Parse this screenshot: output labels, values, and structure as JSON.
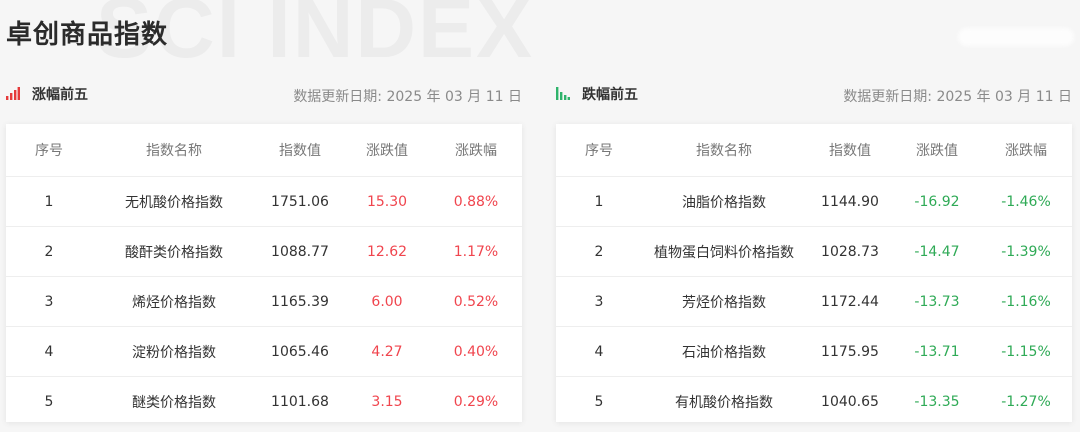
{
  "watermark": "SCI INDEX",
  "page_title": "卓创商品指数",
  "colors": {
    "up": "#f0454e",
    "down": "#2faa56",
    "icon_red": "#e53a3a",
    "icon_green": "#2fb36b"
  },
  "gainers": {
    "icon": "bar-chart-up-icon",
    "title": "涨幅前五",
    "date": "数据更新日期: 2025 年 03 月 11 日",
    "headers": [
      "序号",
      "指数名称",
      "指数值",
      "涨跌值",
      "涨跌幅"
    ],
    "rows": [
      [
        "1",
        "无机酸价格指数",
        "1751.06",
        "15.30",
        "0.88%"
      ],
      [
        "2",
        "酸酐类价格指数",
        "1088.77",
        "12.62",
        "1.17%"
      ],
      [
        "3",
        "烯烃价格指数",
        "1165.39",
        "6.00",
        "0.52%"
      ],
      [
        "4",
        "淀粉价格指数",
        "1065.46",
        "4.27",
        "0.40%"
      ],
      [
        "5",
        "醚类价格指数",
        "1101.68",
        "3.15",
        "0.29%"
      ]
    ]
  },
  "losers": {
    "icon": "bar-chart-down-icon",
    "title": "跌幅前五",
    "date": "数据更新日期: 2025 年 03 月 11 日",
    "headers": [
      "序号",
      "指数名称",
      "指数值",
      "涨跌值",
      "涨跌幅"
    ],
    "rows": [
      [
        "1",
        "油脂价格指数",
        "1144.90",
        "-16.92",
        "-1.46%"
      ],
      [
        "2",
        "植物蛋白饲料价格指数",
        "1028.73",
        "-14.47",
        "-1.39%"
      ],
      [
        "3",
        "芳烃价格指数",
        "1172.44",
        "-13.73",
        "-1.16%"
      ],
      [
        "4",
        "石油价格指数",
        "1175.95",
        "-13.71",
        "-1.15%"
      ],
      [
        "5",
        "有机酸价格指数",
        "1040.65",
        "-13.35",
        "-1.27%"
      ]
    ]
  }
}
